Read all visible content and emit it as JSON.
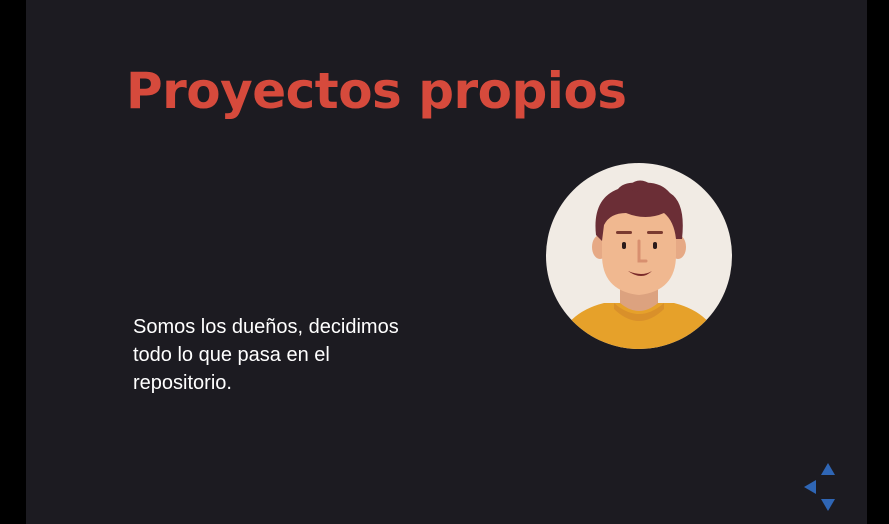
{
  "slide": {
    "title": "Proyectos propios",
    "body_lines": [
      "Somos los dueños, decidimos",
      "todo lo que pasa en el",
      "repositorio."
    ],
    "avatar_icon": "person-avatar-icon"
  },
  "navigation": {
    "up_icon": "arrow-up-icon",
    "left_icon": "arrow-left-icon",
    "down_icon": "arrow-down-icon"
  },
  "colors": {
    "background": "#1c1b21",
    "title": "#d64a3c",
    "body_text": "#ffffff",
    "nav_arrows": "#2f66b5",
    "avatar_background": "#f1ebe4",
    "hair": "#6b2e36",
    "skin": "#f0b890",
    "shirt": "#e6a12a"
  }
}
